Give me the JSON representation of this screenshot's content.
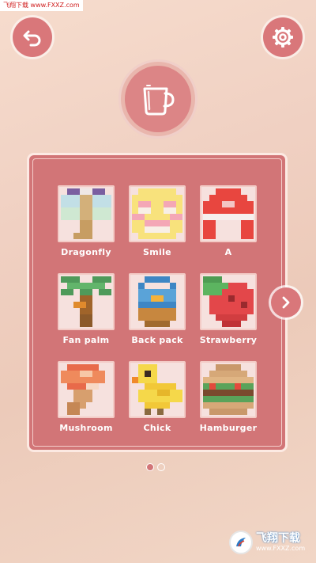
{
  "watermark": {
    "top_text": "飞翔下载 www.FXXZ.com",
    "bottom_cn": "飞翔下载",
    "bottom_url": "www.FXXZ.com"
  },
  "header": {
    "back_icon": "back-arrow-icon",
    "settings_icon": "gear-icon",
    "category_icon": "mug-icon"
  },
  "colors": {
    "accent": "#d9777a",
    "panel": "#d27577",
    "thumb_bg": "#f6e1de"
  },
  "gallery": {
    "items": [
      {
        "label": "Dragonfly",
        "icon": "dragonfly-pixel-art"
      },
      {
        "label": "Smile",
        "icon": "smile-pixel-art"
      },
      {
        "label": "A",
        "icon": "letter-a-pixel-art"
      },
      {
        "label": "Fan palm",
        "icon": "fan-palm-pixel-art"
      },
      {
        "label": "Back pack",
        "icon": "backpack-pixel-art"
      },
      {
        "label": "Strawberry",
        "icon": "strawberry-pixel-art"
      },
      {
        "label": "Mushroom",
        "icon": "mushroom-pixel-art"
      },
      {
        "label": "Chick",
        "icon": "chick-pixel-art"
      },
      {
        "label": "Hamburger",
        "icon": "hamburger-pixel-art"
      }
    ],
    "next_icon": "chevron-right-icon"
  },
  "pagination": {
    "current": 1,
    "total": 2
  }
}
